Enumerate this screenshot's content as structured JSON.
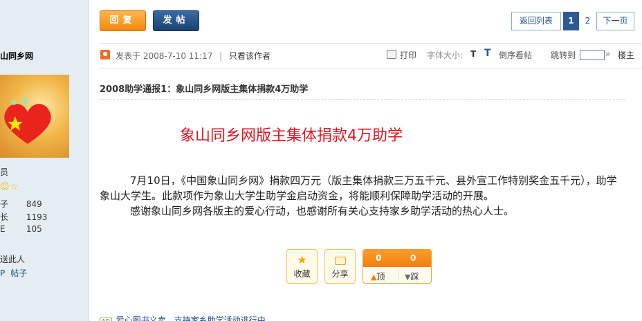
{
  "sidebar": {
    "site_name": "山同乡网",
    "rank": "员",
    "stars": "☺☆",
    "stats": [
      {
        "key": "子",
        "value": "849"
      },
      {
        "key": "长",
        "value": "1193"
      },
      {
        "key": "E",
        "value": "105"
      }
    ],
    "link_contact": "送此人",
    "link_posts_prefix": "P",
    "link_posts": "帖子"
  },
  "toolbar": {
    "reply_label": "回复",
    "post_label": "发帖"
  },
  "pager": {
    "back_label": "返回列表",
    "current_page": "1",
    "page2": "2",
    "next_label": "下一页"
  },
  "post": {
    "posted_at_label": "发表于",
    "posted_at": "2008-7-10 11:17",
    "separator": "|",
    "only_author": "只看该作者",
    "print_label": "打印",
    "font_size_label": "字体大小:",
    "font_t_small": "T",
    "font_t_large": "T",
    "reverse_label": "倒序看帖",
    "jump_label": "跳转到",
    "jump_arrow": "»",
    "floor_label": "楼主",
    "title": "2008助学通报1：象山同乡网版主集体捐款4万助学",
    "headline": "象山同乡网版主集体捐款4万助学",
    "paragraph1": "7月10日，《中国象山同乡网》捐款四万元（版主集体捐款三万五千元、县外宣工作特别奖金五千元），助学象山大学生。此款项作为象山大学生助学金启动资金，将能顺利保障助学活动的开展。",
    "paragraph2": "感谢象山同乡网各版主的爱心行动，也感谢所有关心支持家乡助学活动的热心人士。"
  },
  "actions": {
    "favorite_label": "收藏",
    "share_label": "分享",
    "up_count": "0",
    "down_count": "0",
    "up_label": "顶",
    "down_label": "踩"
  },
  "ad": {
    "tag": "AD",
    "text": "爱心图书义卖，支持家乡助学活动进行中"
  },
  "colors": {
    "headline": "#e8101c",
    "reply_button": "#f38a0e",
    "post_button": "#1b426f",
    "sidebar_bg": "#e5edf2"
  }
}
